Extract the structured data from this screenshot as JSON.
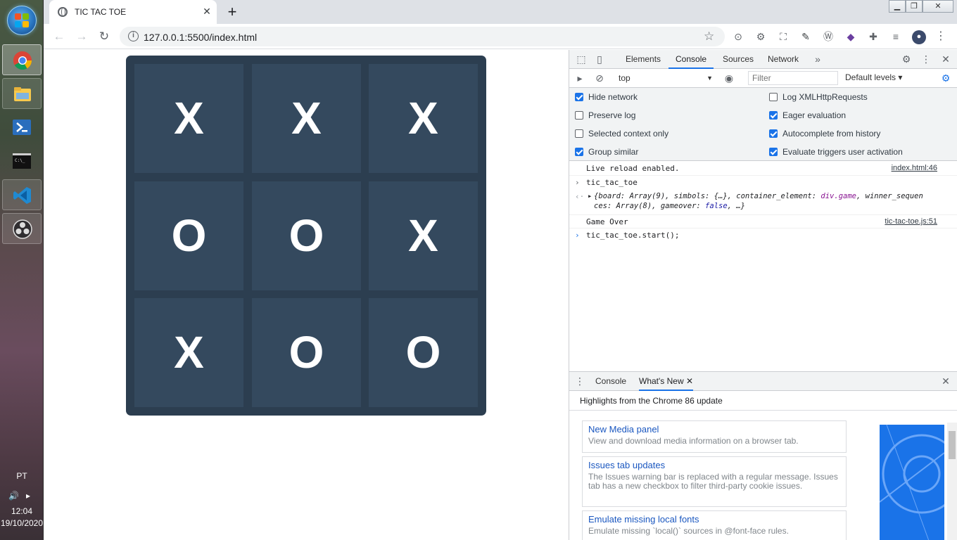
{
  "taskbar": {
    "language": "PT",
    "time": "12:04",
    "date": "19/10/2020"
  },
  "browser": {
    "tab_title": "TIC TAC TOE",
    "url": "127.0.0.1:5500/index.html"
  },
  "game": {
    "cells": [
      "X",
      "X",
      "X",
      "O",
      "O",
      "X",
      "X",
      "O",
      "O"
    ]
  },
  "devtools": {
    "tabs": [
      "Elements",
      "Console",
      "Sources",
      "Network"
    ],
    "context": "top",
    "filter_placeholder": "Filter",
    "levels": "Default levels",
    "settings": {
      "left": [
        {
          "label": "Hide network",
          "checked": true
        },
        {
          "label": "Preserve log",
          "checked": false
        },
        {
          "label": "Selected context only",
          "checked": false
        },
        {
          "label": "Group similar",
          "checked": true
        }
      ],
      "right": [
        {
          "label": "Log XMLHttpRequests",
          "checked": false
        },
        {
          "label": "Eager evaluation",
          "checked": true
        },
        {
          "label": "Autocomplete from history",
          "checked": true
        },
        {
          "label": "Evaluate triggers user activation",
          "checked": true
        }
      ]
    },
    "console": {
      "live_reload": "Live reload enabled.",
      "live_reload_src": "index.html:46",
      "input1": "tic_tac_toe",
      "output_line1_a": "{board: Array(9), simbols: {…}, container_element: ",
      "output_line1_b": "div.game",
      "output_line1_c": ", winner_sequen",
      "output_line2_a": "ces: Array(8), gameover: ",
      "output_line2_b": "false",
      "output_line2_c": ", …}",
      "game_over": "Game Over",
      "game_over_src": "tic-tac-toe.js:51",
      "input2": "tic_tac_toe.start();"
    },
    "drawer": {
      "tabs": [
        "Console",
        "What's New"
      ],
      "heading": "Highlights from the Chrome 86 update",
      "cards": [
        {
          "title": "New Media panel",
          "desc": "View and download media information on a browser tab."
        },
        {
          "title": "Issues tab updates",
          "desc": "The Issues warning bar is replaced with a regular message. Issues tab has a new checkbox to filter third-party cookie issues."
        },
        {
          "title": "Emulate missing local fonts",
          "desc": "Emulate missing `local()` sources in @font-face rules."
        }
      ]
    }
  }
}
